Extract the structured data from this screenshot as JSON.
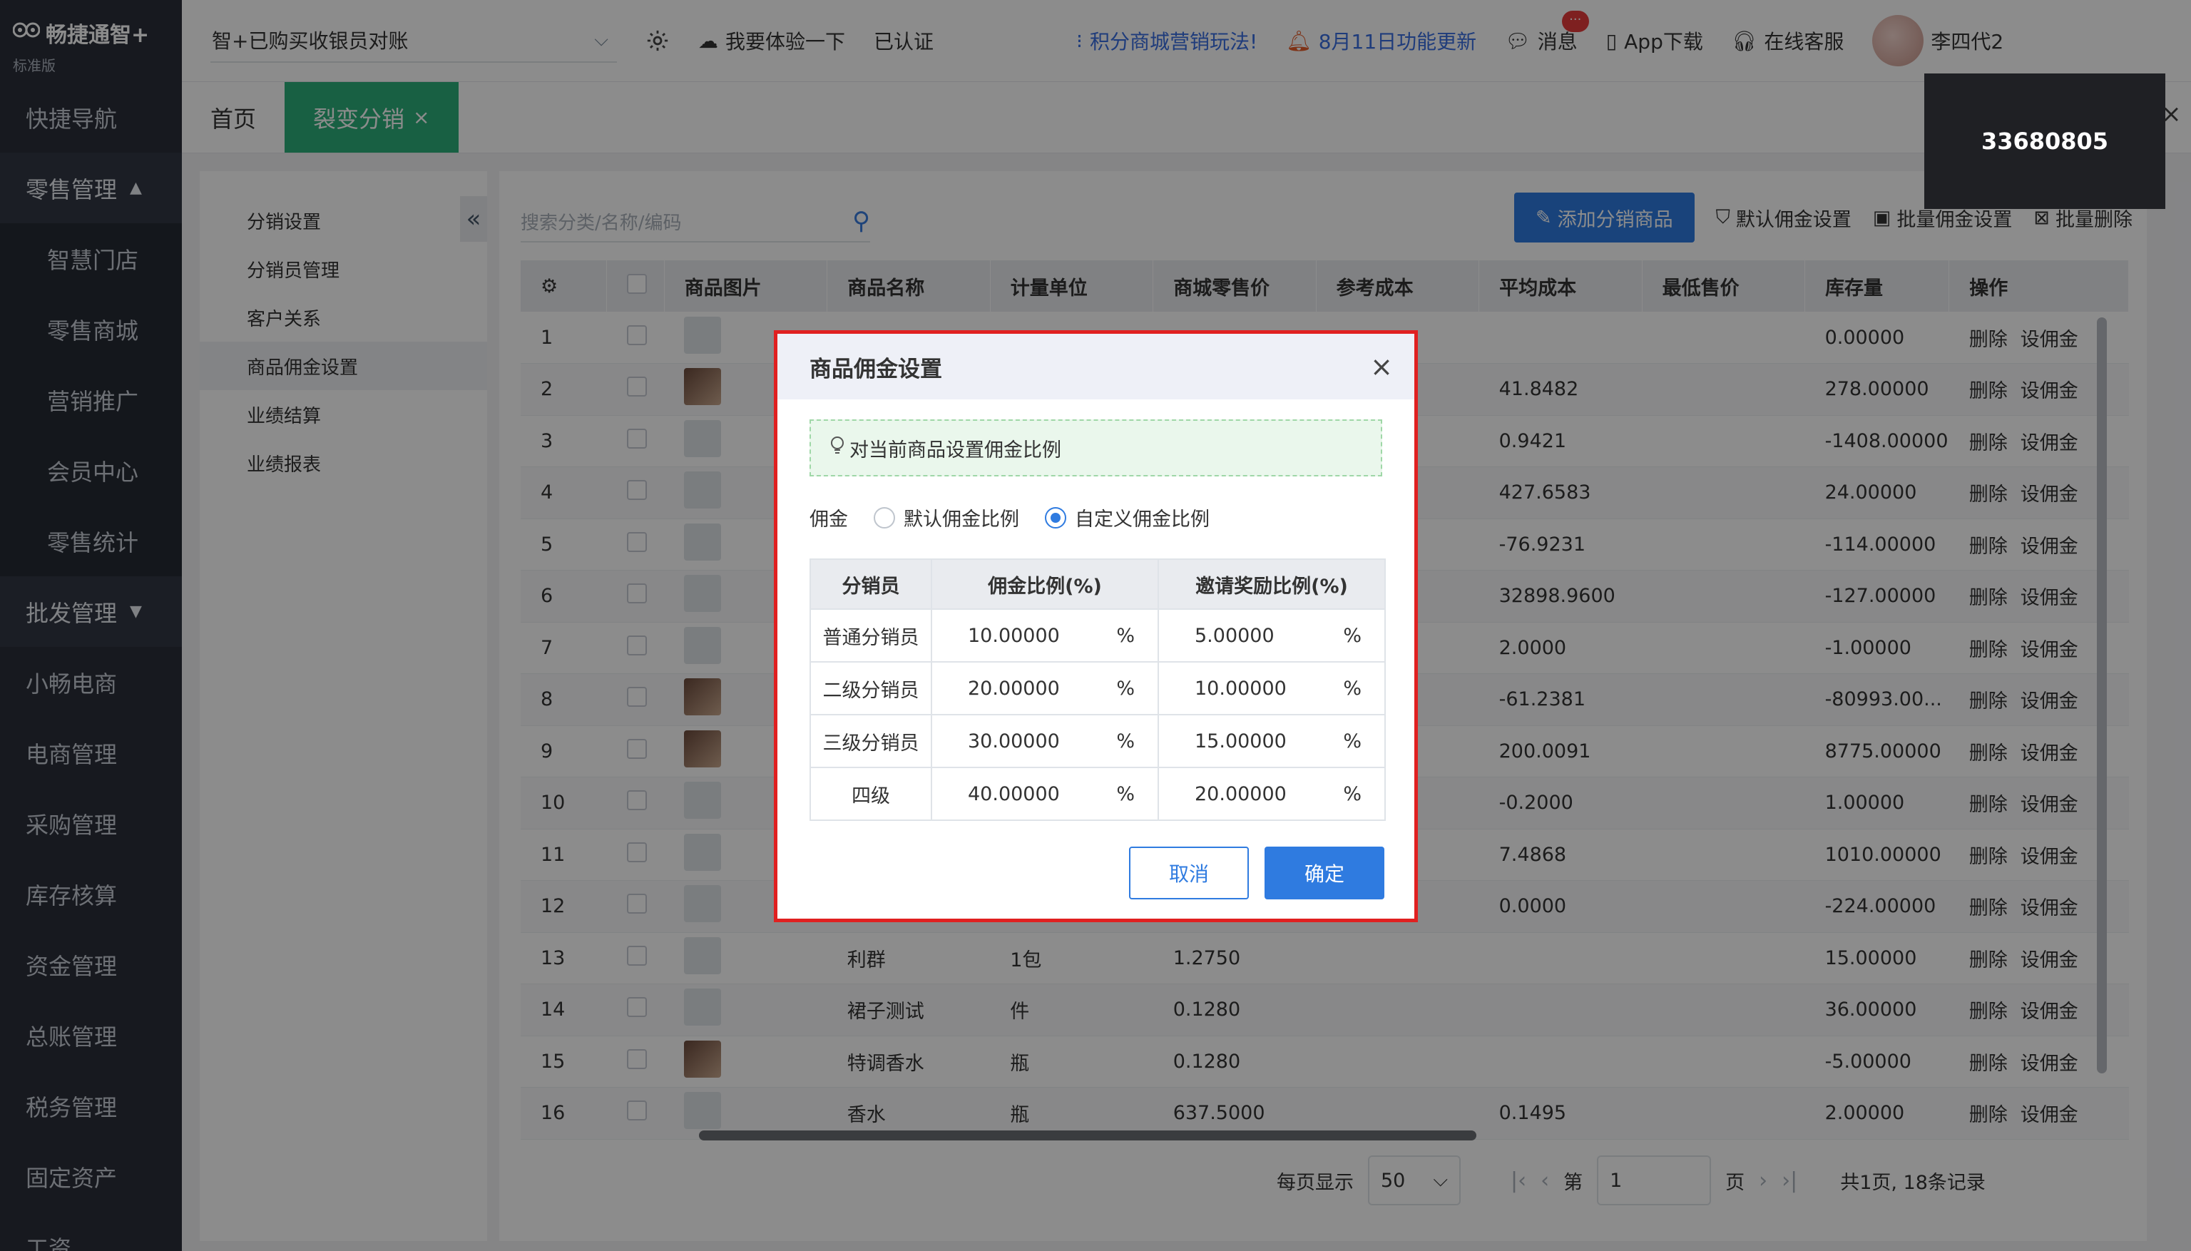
{
  "app": {
    "name": "畅捷通智+",
    "edition": "标准版"
  },
  "sidebar": {
    "items": [
      {
        "label": "快捷导航",
        "type": "item"
      },
      {
        "label": "零售管理",
        "type": "group",
        "arrow": "▲"
      },
      {
        "label": "智慧门店",
        "type": "sub"
      },
      {
        "label": "零售商城",
        "type": "sub"
      },
      {
        "label": "营销推广",
        "type": "sub"
      },
      {
        "label": "会员中心",
        "type": "sub"
      },
      {
        "label": "零售统计",
        "type": "sub"
      },
      {
        "label": "批发管理",
        "type": "group",
        "arrow": "▼"
      },
      {
        "label": "小畅电商",
        "type": "item"
      },
      {
        "label": "电商管理",
        "type": "item"
      },
      {
        "label": "采购管理",
        "type": "item"
      },
      {
        "label": "库存核算",
        "type": "item"
      },
      {
        "label": "资金管理",
        "type": "item"
      },
      {
        "label": "总账管理",
        "type": "item"
      },
      {
        "label": "税务管理",
        "type": "item"
      },
      {
        "label": "固定资产",
        "type": "item"
      },
      {
        "label": "工资",
        "type": "item"
      }
    ]
  },
  "header": {
    "store": "智+已购买收银员对账",
    "try_it": "我要体验一下",
    "verified": "已认证",
    "promo": "积分商城营销玩法!",
    "update": "8月11日功能更新",
    "messages": "消息",
    "messages_badge": "···",
    "app_download": "App下载",
    "support": "在线客服",
    "user": "李四代2"
  },
  "tabs": [
    {
      "label": "首页",
      "active": false
    },
    {
      "label": "裂变分销",
      "active": true,
      "close": "×"
    }
  ],
  "submenu": {
    "items": [
      "分销设置",
      "分销员管理",
      "客户关系",
      "商品佣金设置",
      "业绩结算",
      "业绩报表"
    ],
    "active_index": 3,
    "collapse": "«"
  },
  "main": {
    "search_placeholder": "搜索分类/名称/编码",
    "add_button": "添加分销商品",
    "default_commission": "默认佣金设置",
    "batch_commission": "批量佣金设置",
    "batch_delete": "批量删除",
    "columns": [
      "",
      "",
      "商品图片",
      "商品名称",
      "计量单位",
      "商城零售价",
      "参考成本",
      "平均成本",
      "最低售价",
      "库存量",
      "操作"
    ],
    "rows": [
      {
        "no": "1",
        "photo": false,
        "name": "",
        "unit": "",
        "price": "",
        "avg": "",
        "stock": "0.00000"
      },
      {
        "no": "2",
        "photo": true,
        "name": "",
        "unit": "",
        "price": "",
        "avg": "41.8482",
        "stock": "278.00000"
      },
      {
        "no": "3",
        "photo": false,
        "name": "",
        "unit": "",
        "price": "",
        "avg": "0.9421",
        "stock": "-1408.00000"
      },
      {
        "no": "4",
        "photo": false,
        "name": "",
        "unit": "",
        "price": "",
        "avg": "427.6583",
        "stock": "24.00000"
      },
      {
        "no": "5",
        "photo": false,
        "name": "",
        "unit": "",
        "price": "",
        "avg": "-76.9231",
        "stock": "-114.00000"
      },
      {
        "no": "6",
        "photo": false,
        "name": "",
        "unit": "",
        "price": "",
        "avg": "32898.9600",
        "stock": "-127.00000"
      },
      {
        "no": "7",
        "photo": false,
        "name": "",
        "unit": "",
        "price": "",
        "avg": "2.0000",
        "stock": "-1.00000"
      },
      {
        "no": "8",
        "photo": true,
        "name": "",
        "unit": "",
        "price": "",
        "avg": "-61.2381",
        "stock": "-80993.00..."
      },
      {
        "no": "9",
        "photo": true,
        "name": "",
        "unit": "",
        "price": "",
        "avg": "200.0091",
        "stock": "8775.00000"
      },
      {
        "no": "10",
        "photo": false,
        "name": "",
        "unit": "",
        "price": "",
        "avg": "-0.2000",
        "stock": "1.00000"
      },
      {
        "no": "11",
        "photo": false,
        "name": "",
        "unit": "",
        "price": "",
        "avg": "7.4868",
        "stock": "1010.00000"
      },
      {
        "no": "12",
        "photo": false,
        "name": "",
        "unit": "",
        "price": "",
        "avg": "0.0000",
        "stock": "-224.00000"
      },
      {
        "no": "13",
        "photo": false,
        "name": "利群",
        "unit": "1包",
        "price": "1.2750",
        "avg": "",
        "stock": "15.00000"
      },
      {
        "no": "14",
        "photo": false,
        "name": "裙子测试",
        "unit": "件",
        "price": "0.1280",
        "avg": "",
        "stock": "36.00000"
      },
      {
        "no": "15",
        "photo": true,
        "name": "特调香水",
        "unit": "瓶",
        "price": "0.1280",
        "avg": "",
        "stock": "-5.00000"
      },
      {
        "no": "16",
        "photo": false,
        "name": "香水",
        "unit": "瓶",
        "price": "637.5000",
        "avg": "0.1495",
        "stock": "2.00000"
      }
    ],
    "op_delete": "删除",
    "op_set": "设佣金"
  },
  "pager": {
    "per_page_label": "每页显示",
    "per_page": "50",
    "page_prefix": "第",
    "page": "1",
    "page_suffix": "页",
    "summary": "共1页, 18条记录"
  },
  "tooltip": {
    "text": "33680805",
    "close": "×"
  },
  "modal": {
    "title": "商品佣金设置",
    "close": "×",
    "tip": "对当前商品设置佣金比例",
    "commission_label": "佣金",
    "option_default": "默认佣金比例",
    "option_custom": "自定义佣金比例",
    "selected": "custom",
    "columns": [
      "分销员",
      "佣金比例(%)",
      "邀请奖励比例(%)"
    ],
    "rows": [
      {
        "level": "普通分销员",
        "rate": "10.00000",
        "invite": "5.00000"
      },
      {
        "level": "二级分销员",
        "rate": "20.00000",
        "invite": "10.00000"
      },
      {
        "level": "三级分销员",
        "rate": "30.00000",
        "invite": "15.00000"
      },
      {
        "level": "四级",
        "rate": "40.00000",
        "invite": "20.00000"
      }
    ],
    "percent": "%",
    "cancel": "取消",
    "ok": "确定"
  },
  "colors": {
    "accent": "#2f7be0",
    "active_tab": "#2db07a",
    "sidebar": "#2b2f3a",
    "modal_border": "#e02020"
  }
}
